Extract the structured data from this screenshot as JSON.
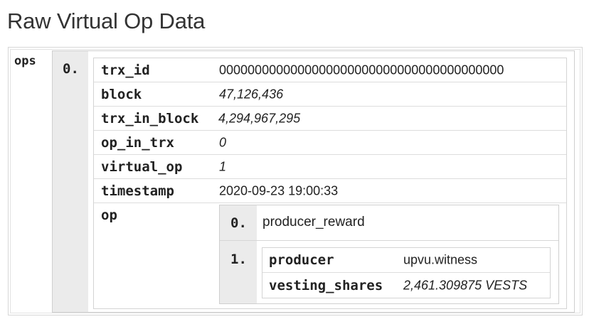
{
  "page": {
    "title": "Raw Virtual Op Data"
  },
  "ops": {
    "key": "ops",
    "items": [
      {
        "index": "0.",
        "fields": [
          {
            "key": "trx_id",
            "value": "0000000000000000000000000000000000000000"
          },
          {
            "key": "block",
            "value": "47,126,436"
          },
          {
            "key": "trx_in_block",
            "value": "4,294,967,295"
          },
          {
            "key": "op_in_trx",
            "value": "0"
          },
          {
            "key": "virtual_op",
            "value": "1"
          },
          {
            "key": "timestamp",
            "value": "2020-09-23 19:00:33"
          }
        ],
        "op": {
          "key": "op",
          "entries": [
            {
              "index": "0.",
              "value": "producer_reward"
            },
            {
              "index": "1.",
              "params": [
                {
                  "key": "producer",
                  "value": "upvu.witness"
                },
                {
                  "key": "vesting_shares",
                  "value": "2,461.309875 VESTS"
                }
              ]
            }
          ]
        }
      }
    ]
  }
}
